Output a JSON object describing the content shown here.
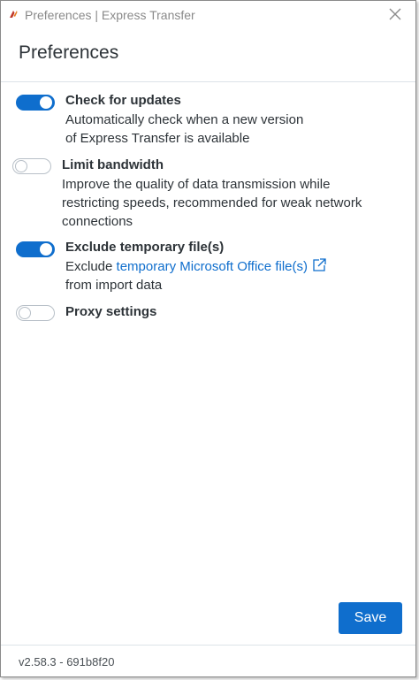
{
  "window": {
    "title": "Preferences | Express Transfer",
    "close_icon": "close-icon",
    "app_icon": "express-transfer-logo-icon"
  },
  "header": {
    "title": "Preferences"
  },
  "settings": [
    {
      "title": "Check for updates",
      "enabled": true,
      "desc_line1": "Automatically check when a new version",
      "desc_line2": "of Express Transfer is available"
    },
    {
      "title": "Limit bandwidth",
      "enabled": false,
      "desc_line1": "Improve the quality of data transmission while",
      "desc_line2": "restricting speeds, recommended for weak network",
      "desc_line3": "connections"
    },
    {
      "title": "Exclude temporary file(s)",
      "enabled": true,
      "desc_prefix": "Exclude ",
      "desc_link": "temporary Microsoft Office file(s)",
      "desc_link_icon": "external-link-icon",
      "desc_line2": "from import data"
    },
    {
      "title": "Proxy settings",
      "enabled": false
    }
  ],
  "actions": {
    "save_label": "Save"
  },
  "footer": {
    "version": "v2.58.3 - 691b8f20"
  },
  "colors": {
    "accent": "#0f6ecd",
    "text": "#2d3338",
    "title_gray": "#8a8a8a",
    "divider": "#dde3e8"
  }
}
